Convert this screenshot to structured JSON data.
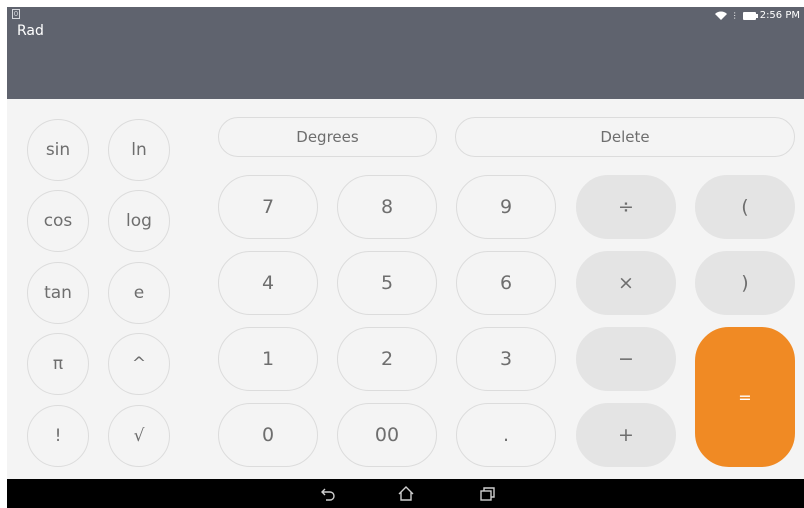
{
  "status": {
    "sim_label": "0",
    "time": "2:56 PM"
  },
  "mode": "Rad",
  "buttons": {
    "sin": "sin",
    "ln": "ln",
    "cos": "cos",
    "log": "log",
    "tan": "tan",
    "e": "e",
    "pi": "π",
    "power": "^",
    "factorial": "!",
    "sqrt": "√",
    "degrees": "Degrees",
    "delete": "Delete",
    "d7": "7",
    "d8": "8",
    "d9": "9",
    "divide": "÷",
    "lparen": "(",
    "d4": "4",
    "d5": "5",
    "d6": "6",
    "multiply": "×",
    "rparen": ")",
    "d1": "1",
    "d2": "2",
    "d3": "3",
    "minus": "−",
    "equals": "=",
    "d0": "0",
    "d00": "00",
    "dot": ".",
    "plus": "+"
  },
  "navbar": {
    "icons": [
      "back-icon",
      "home-icon",
      "recent-apps-icon"
    ]
  },
  "colors": {
    "statusbar": "#5f636e",
    "keypad_bg": "#f4f4f4",
    "equals_accent": "#f08a24"
  }
}
